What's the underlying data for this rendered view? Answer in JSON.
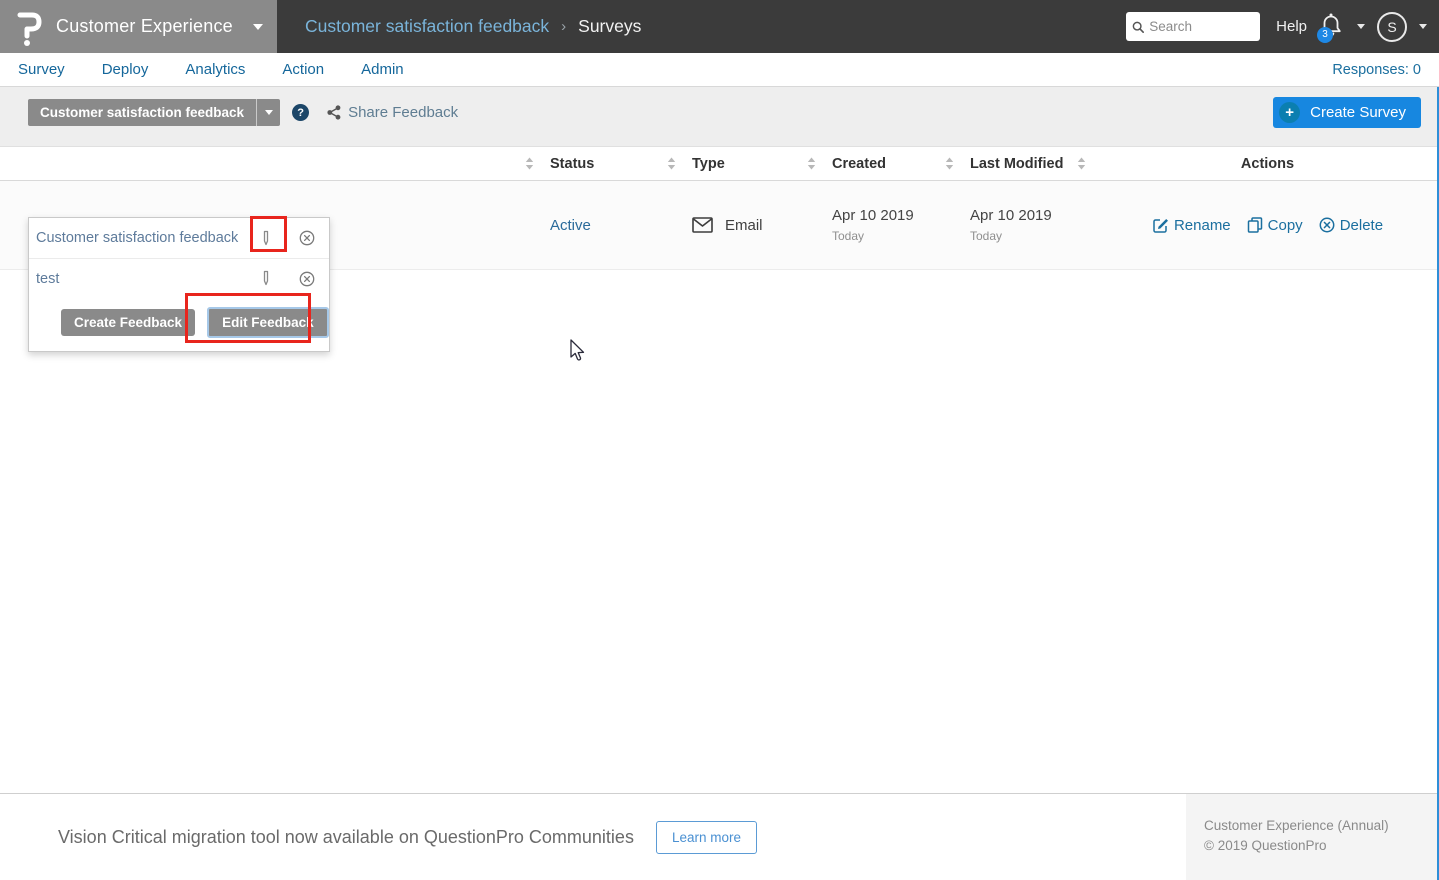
{
  "header": {
    "product": "Customer Experience",
    "breadcrumb": {
      "parent": "Customer satisfaction feedback",
      "separator": "›",
      "current": "Surveys"
    },
    "search_placeholder": "Search",
    "help_label": "Help",
    "notification_count": "3",
    "avatar_initial": "S"
  },
  "nav": {
    "tabs": [
      "Survey",
      "Deploy",
      "Analytics",
      "Action",
      "Admin"
    ],
    "responses_label": "Responses: 0"
  },
  "toolbar": {
    "survey_selector_label": "Customer satisfaction feedback",
    "help_glyph": "?",
    "share_label": "Share Feedback",
    "create_survey_label": "Create Survey",
    "plus_glyph": "+"
  },
  "feedback_dropdown": {
    "items": [
      {
        "label": "Customer satisfaction feedback"
      },
      {
        "label": "test"
      }
    ],
    "create_button": "Create Feedback",
    "edit_button": "Edit Feedback"
  },
  "table": {
    "headers": {
      "status": "Status",
      "type": "Type",
      "created": "Created",
      "modified": "Last Modified",
      "actions": "Actions"
    },
    "row": {
      "status": "Active",
      "type": "Email",
      "created": "Apr 10 2019",
      "created_sub": "Today",
      "modified": "Apr 10 2019",
      "modified_sub": "Today",
      "actions": [
        "Rename",
        "Copy",
        "Delete"
      ]
    }
  },
  "footer": {
    "banner_text": "Vision Critical migration tool now available on QuestionPro Communities",
    "learn_more_label": "Learn more",
    "plan_label": "Customer Experience (Annual)",
    "copyright": "© 2019 QuestionPro"
  },
  "colors": {
    "topbar": "#3b3b3b",
    "brand_gray": "#8a8a8a",
    "breadcrumb_blue": "#7ab4da",
    "link_blue": "#1b6f9f",
    "accent_blue": "#1787e0",
    "badge_blue": "#1e88e5",
    "highlight_red": "#e8251d",
    "toolbar_gray": "#eeeeee",
    "footer_block_gray": "#f4f4f4"
  }
}
